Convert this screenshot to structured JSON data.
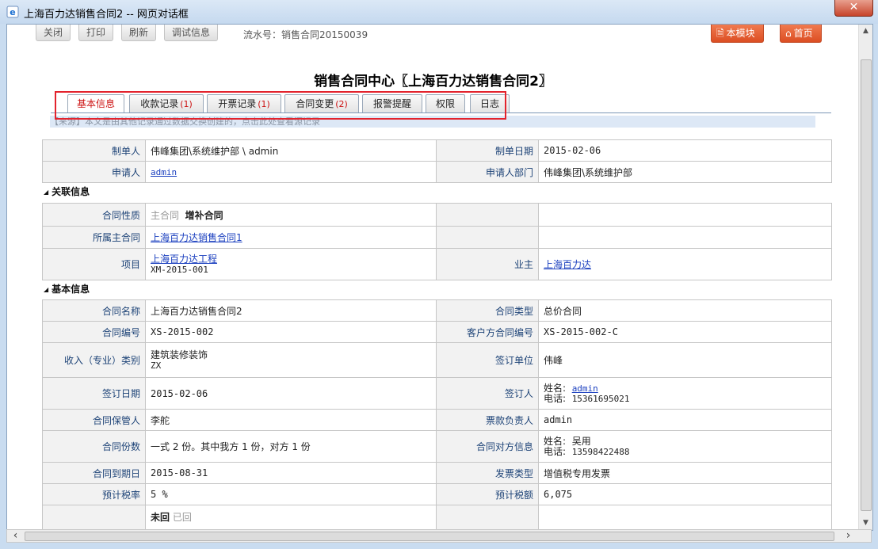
{
  "window": {
    "title": "上海百力达销售合同2 -- 网页对话框",
    "close_label": "✕"
  },
  "toolbar": {
    "buttons": [
      "关闭",
      "打印",
      "刷新",
      "调试信息"
    ],
    "serial_label": "流水号：销售合同20150039",
    "module_label": "本模块",
    "home_label": "首页"
  },
  "page_title": "销售合同中心〖上海百力达销售合同2〗",
  "tabs": [
    {
      "label": "基本信息",
      "count": ""
    },
    {
      "label": "收款记录",
      "count": "(1)"
    },
    {
      "label": "开票记录",
      "count": "(1)"
    },
    {
      "label": "合同变更",
      "count": "(2)"
    },
    {
      "label": "报警提醒",
      "count": ""
    },
    {
      "label": "权限",
      "count": ""
    },
    {
      "label": "日志",
      "count": ""
    }
  ],
  "notice": "【来源】本文是由其他记录通过数据交换创建的，点击此处查看源记录",
  "top_table": {
    "creator_label": "制单人",
    "creator_value": "伟峰集团\\系统维护部 \\ admin",
    "date_label": "制单日期",
    "date_value": "2015-02-06",
    "applicant_label": "申请人",
    "applicant_value": "admin",
    "dept_label": "申请人部门",
    "dept_value": "伟峰集团\\系统维护部"
  },
  "related": {
    "section_title": "关联信息",
    "nature_label": "合同性质",
    "nature_main": "主合同",
    "nature_supp": "增补合同",
    "parent_label": "所属主合同",
    "parent_value": "上海百力达销售合同1",
    "project_label": "项目",
    "project_name": "上海百力达工程",
    "project_code": "XM-2015-001",
    "owner_label": "业主",
    "owner_value": "上海百力达"
  },
  "basic": {
    "section_title": "基本信息",
    "name_label": "合同名称",
    "name_value": "上海百力达销售合同2",
    "type_label": "合同类型",
    "type_value": "总价合同",
    "code_label": "合同编号",
    "code_value": "XS-2015-002",
    "client_code_label": "客户方合同编号",
    "client_code_value": "XS-2015-002-C",
    "category_label": "收入（专业）类别",
    "category_value": "建筑装修装饰",
    "category_code": "ZX",
    "sign_unit_label": "签订单位",
    "sign_unit_value": "伟峰",
    "sign_date_label": "签订日期",
    "sign_date_value": "2015-02-06",
    "signer_label": "签订人",
    "signer_name_label": "姓名:",
    "signer_name": "admin",
    "signer_phone_label": "电话:",
    "signer_phone": "15361695021",
    "keeper_label": "合同保管人",
    "keeper_value": "李舵",
    "invoice_owner_label": "票款负责人",
    "invoice_owner_value": "admin",
    "copies_label": "合同份数",
    "copies_value": "一式 2 份。其中我方 1 份，对方 1 份",
    "counterpart_label": "合同对方信息",
    "cp_name_label": "姓名:",
    "cp_name": "吴用",
    "cp_phone_label": "电话:",
    "cp_phone": "13598422488",
    "expire_label": "合同到期日",
    "expire_value": "2015-08-31",
    "invoice_type_label": "发票类型",
    "invoice_type_value": "增值税专用发票",
    "tax_rate_label": "预计税率",
    "tax_rate_value": "5 %",
    "tax_amount_label": "预计税额",
    "tax_amount_value": "6,075",
    "return_not": "未回",
    "return_done": "已回"
  }
}
